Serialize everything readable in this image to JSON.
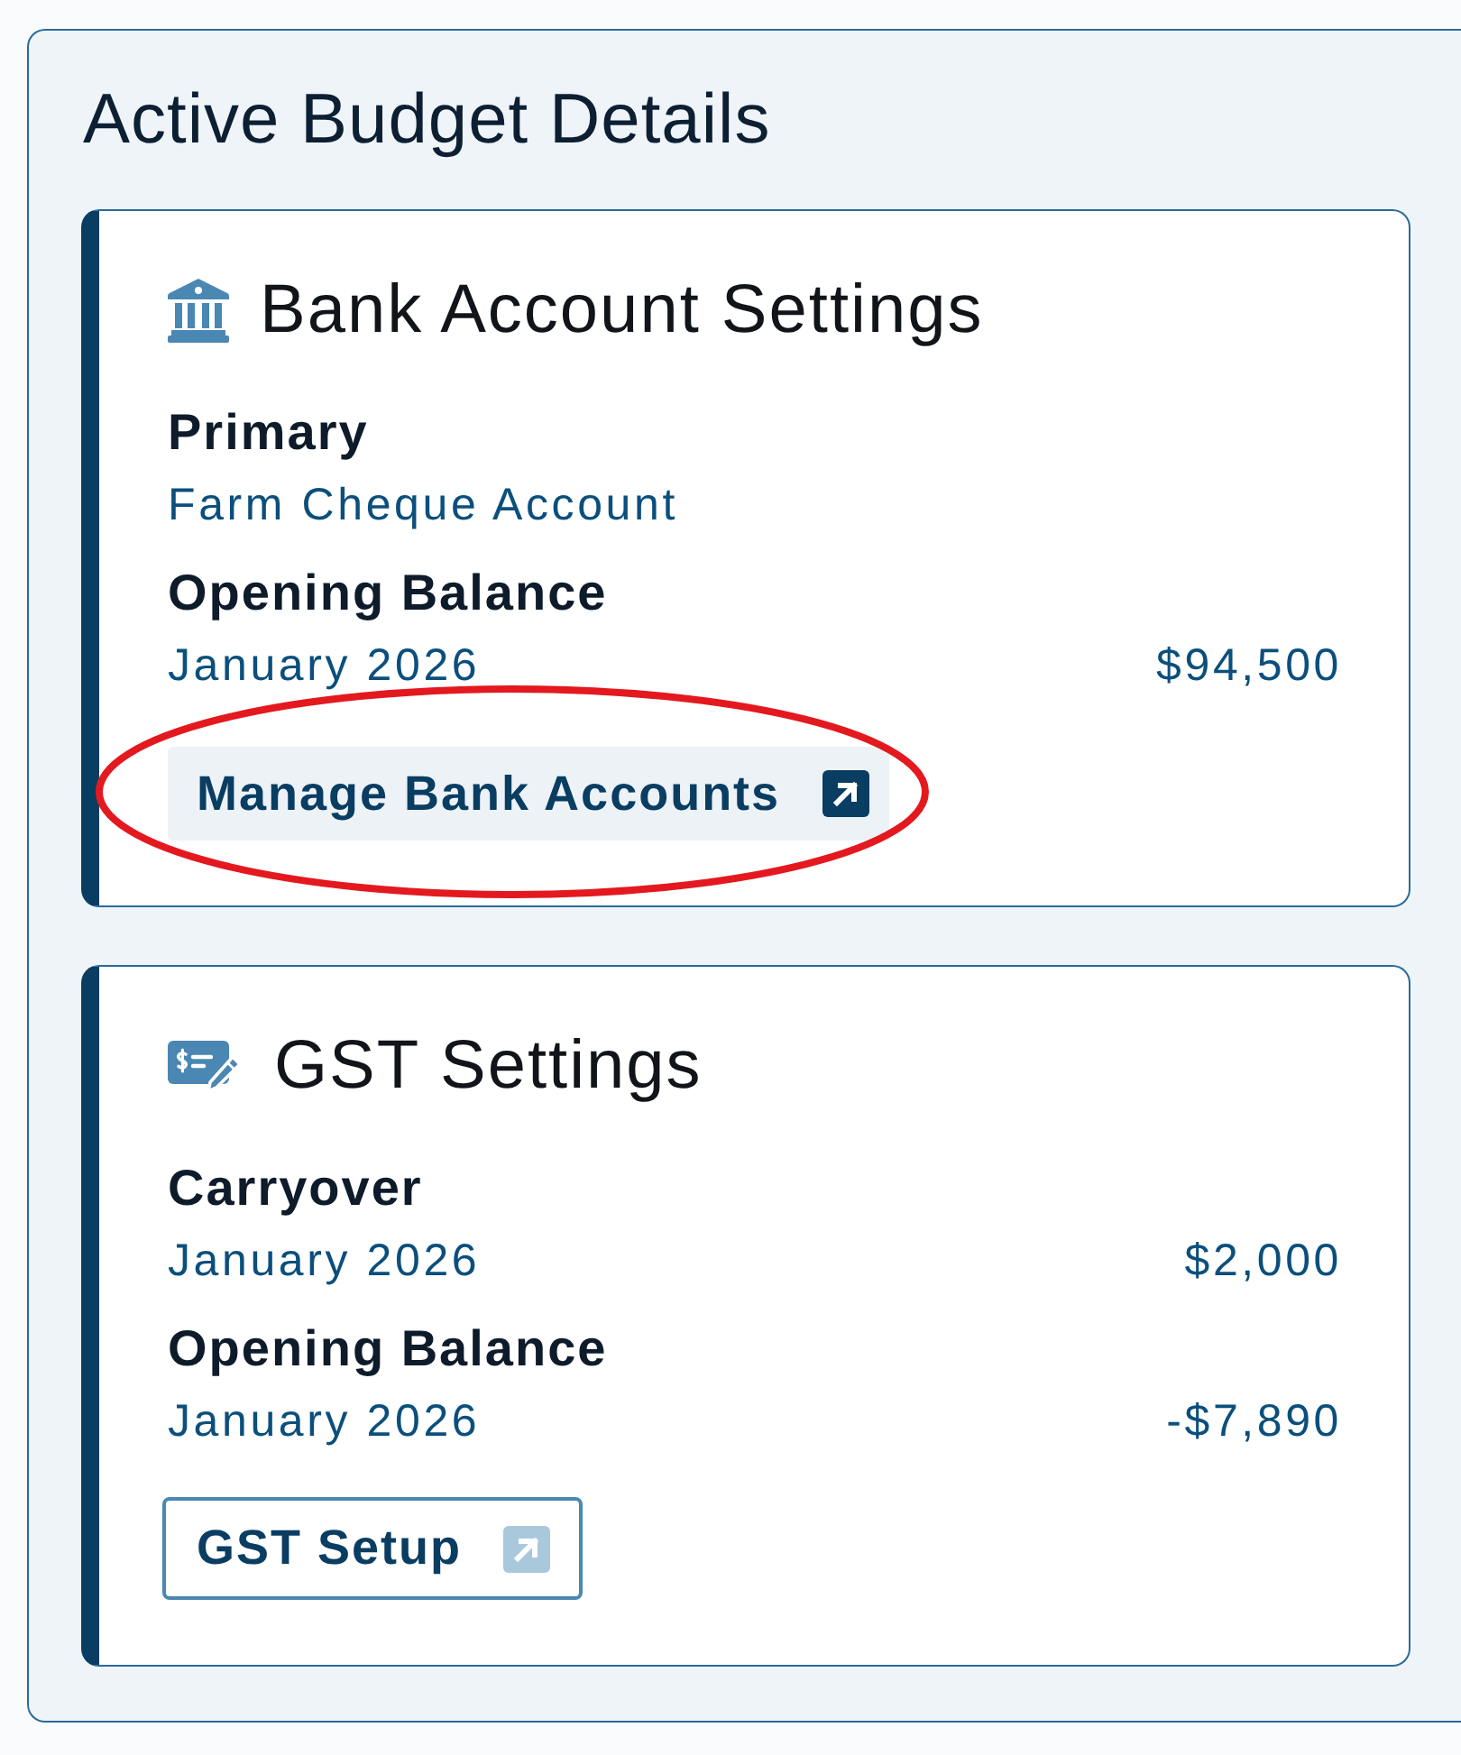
{
  "panel": {
    "title": "Active Budget Details"
  },
  "cards": [
    {
      "kind": "bank",
      "title": "Bank Account Settings",
      "fields": [
        {
          "label": "Primary",
          "value": "Farm Cheque Account"
        },
        {
          "label": "Opening Balance",
          "value": "January 2026",
          "amount": "$94,500"
        }
      ],
      "button": {
        "label": "Manage Bank Accounts",
        "kind": "filled",
        "circled": true
      }
    },
    {
      "kind": "gst",
      "title": "GST Settings",
      "fields": [
        {
          "label": "Carryover",
          "value": "January 2026",
          "amount": "$2,000"
        },
        {
          "label": "Opening Balance",
          "value": "January 2026",
          "amount": "-$7,890"
        }
      ],
      "button": {
        "label": "GST Setup",
        "kind": "outlined",
        "circled": false
      }
    }
  ]
}
